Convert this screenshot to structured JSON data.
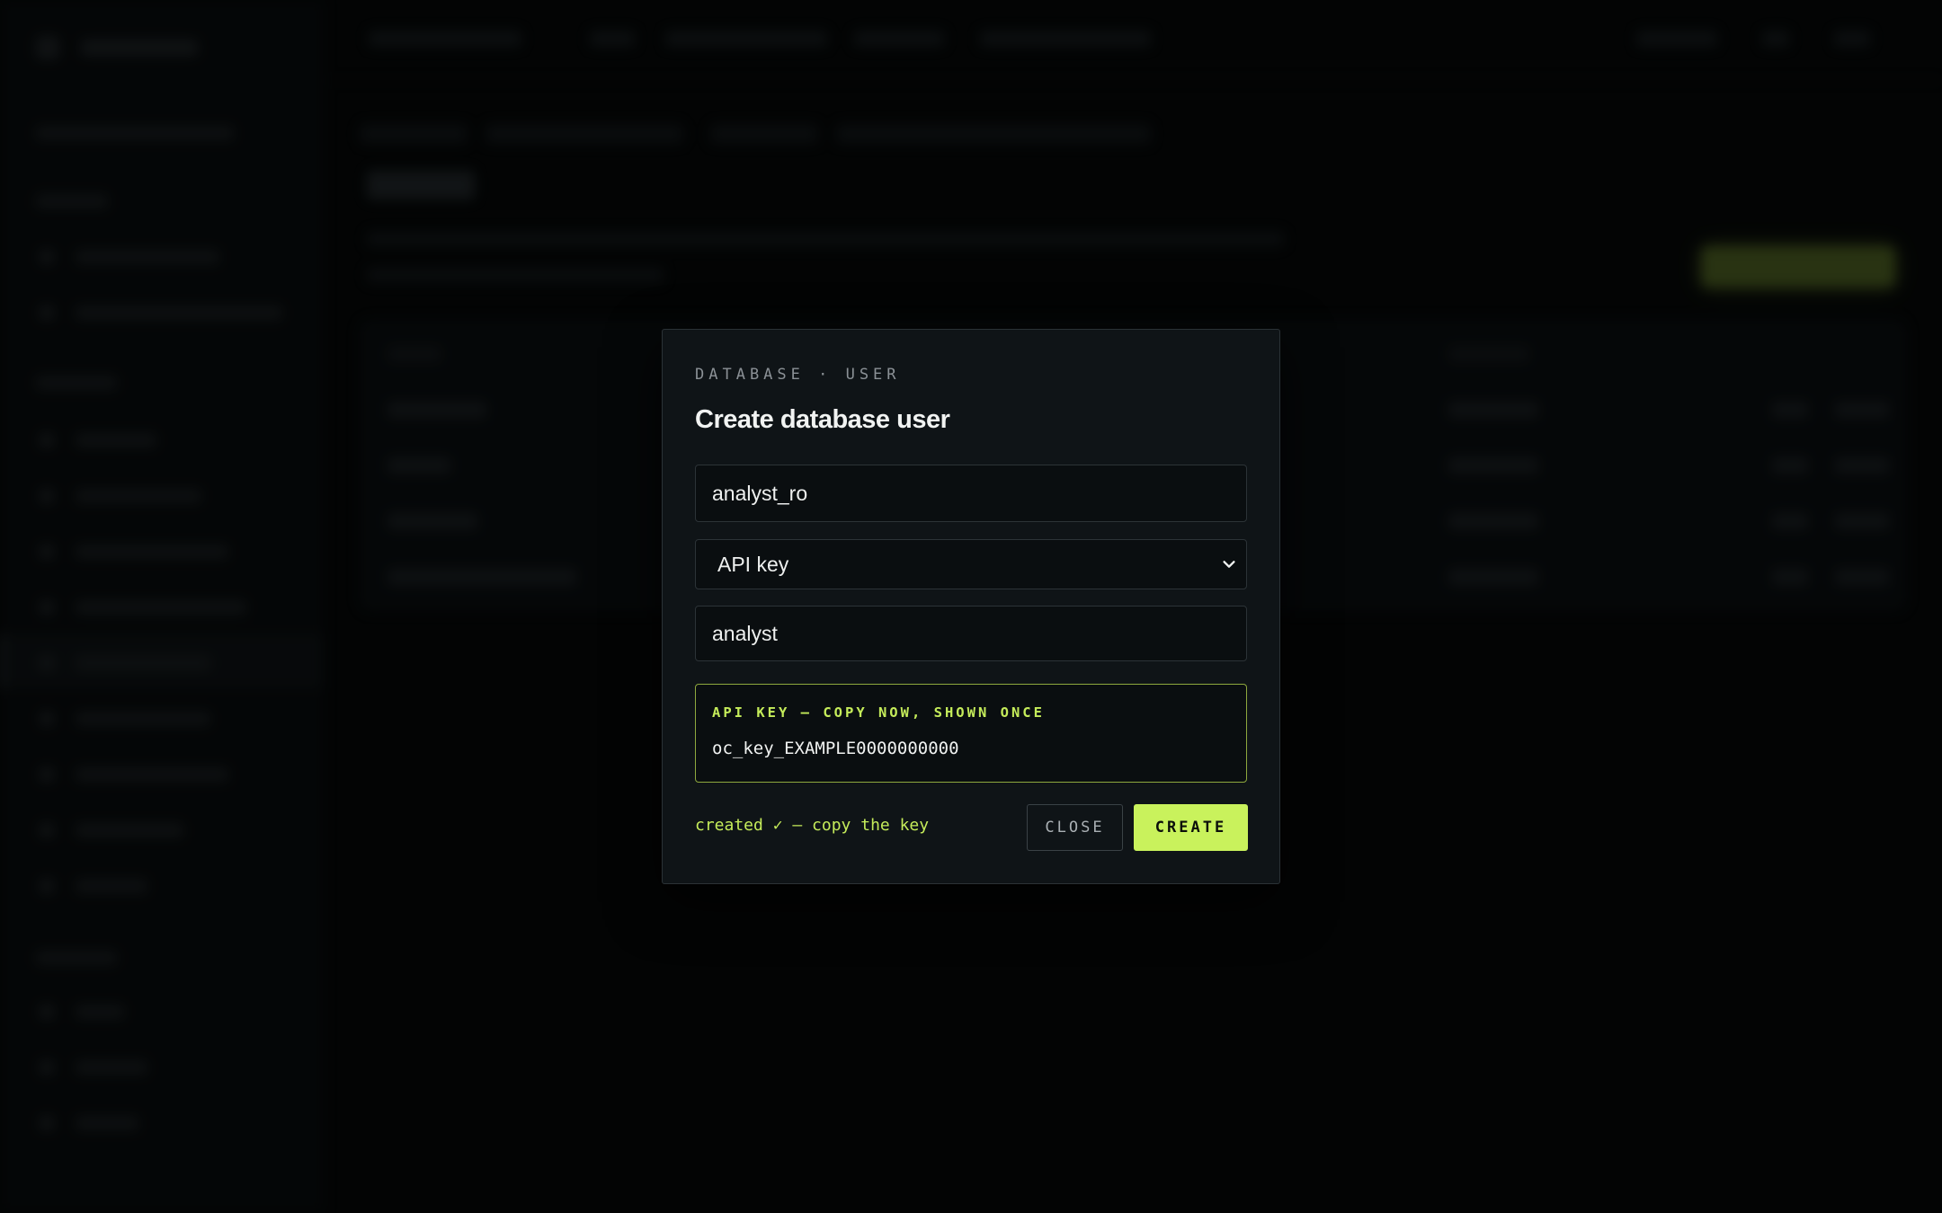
{
  "modal": {
    "eyebrow": "DATABASE · USER",
    "title": "Create database user",
    "username_value": "analyst_ro",
    "auth_type": {
      "selected": "API key"
    },
    "role_value": "analyst",
    "api_key": {
      "label": "API KEY — COPY NOW, SHOWN ONCE",
      "value": "oc_key_EXAMPLE0000000000"
    },
    "status": "created ✓ — copy the key",
    "close_label": "CLOSE",
    "create_label": "CREATE"
  },
  "colors": {
    "accent": "#c9f25c",
    "modal_bg": "#0f1417",
    "page_bg": "#050707"
  }
}
